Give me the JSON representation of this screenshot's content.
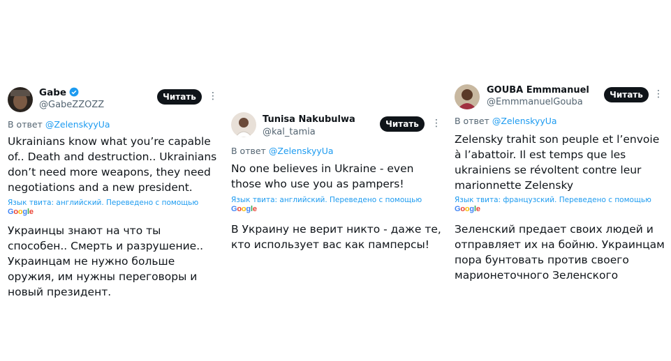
{
  "tweets": [
    {
      "name": "Gabe",
      "handle": "@GabeZZOZZ",
      "verified": true,
      "read_label": "Читать",
      "reply_prefix": "В ответ",
      "reply_to": "@ZelenskyyUa",
      "original_text": "Ukrainians know what you’re capable of.. Death and destruction..  Ukrainians don’t need more weapons, they need negotiations and a new president.",
      "lang_note": "Язык твита: английский. Переведено с помощью",
      "translated_text": "Украинцы знают на что ты способен.. Смерть и разрушение.. Украинцам не нужно больше оружия, им нужны переговоры и новый президент."
    },
    {
      "name": "Tunisa Nakubulwa",
      "handle": "@kal_tamia",
      "verified": false,
      "read_label": "Читать",
      "reply_prefix": "В ответ",
      "reply_to": "@ZelenskyyUa",
      "original_text": "No one believes in Ukraine - even those who use you as pampers!",
      "lang_note": "Язык твита: английский. Переведено с помощью",
      "translated_text": "В Украину не верит никто - даже те, кто использует вас как памперсы!"
    },
    {
      "name": "GOUBA Emmmanuel",
      "handle": "@EmmmanuelGouba",
      "verified": false,
      "read_label": "Читать",
      "reply_prefix": "В ответ",
      "reply_to": "@ZelenskyyUa",
      "original_text": "Zelensky trahit son peuple et l’envoie à l’abattoir. Il est temps que les ukrainiens se révoltent contre leur marionnette Zelensky",
      "lang_note": "Язык твита: французский. Переведено с помощью",
      "translated_text": "Зеленский предает своих людей и отправляет их на бойню. Украинцам пора бунтовать против своего марионеточного Зеленского"
    }
  ],
  "google_logo": "Google",
  "colors": {
    "accent": "#1d9bf0",
    "text": "#0f1419",
    "muted": "#536471",
    "button": "#0f1419"
  }
}
